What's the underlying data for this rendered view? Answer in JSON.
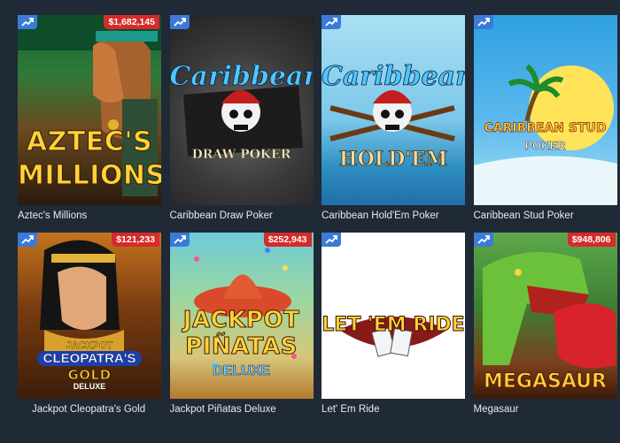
{
  "games": [
    {
      "title": "Aztec's Millions",
      "jackpot": "$1,682,145",
      "art_line1": "AZTEC'S",
      "art_line2": "MILLIONS"
    },
    {
      "title": "Caribbean Draw Poker",
      "jackpot": null,
      "art_line1": "Caribbean",
      "art_line2": "DRAW POKER"
    },
    {
      "title": "Caribbean Hold'Em Poker",
      "jackpot": null,
      "art_line1": "Caribbean",
      "art_line2": "HOLD'EM"
    },
    {
      "title": "Caribbean Stud Poker",
      "jackpot": null,
      "art_line1": "CARIBBEAN STUD",
      "art_line2": "POKER"
    },
    {
      "title": "Jackpot Cleopatra's Gold",
      "jackpot": "$121,233",
      "art_line1": "JACKPOT",
      "art_line2": "CLEOPATRA'S",
      "art_line3": "GOLD",
      "art_line4": "DELUXE"
    },
    {
      "title": "Jackpot Piñatas Deluxe",
      "jackpot": "$252,943",
      "art_line1": "JACKPOT",
      "art_line2": "PIÑATAS",
      "art_line3": "DELUXE"
    },
    {
      "title": "Let' Em Ride",
      "jackpot": null,
      "art_line1": "LET 'EM RIDE"
    },
    {
      "title": "Megasaur",
      "jackpot": "$948,806",
      "art_line1": "MEGASAUR"
    }
  ],
  "colors": {
    "background": "#1f2a36",
    "jackpot_badge": "#d52b2b",
    "trend_badge": "#3b7ad9"
  },
  "icons": {
    "trend": "trending-up-icon"
  }
}
